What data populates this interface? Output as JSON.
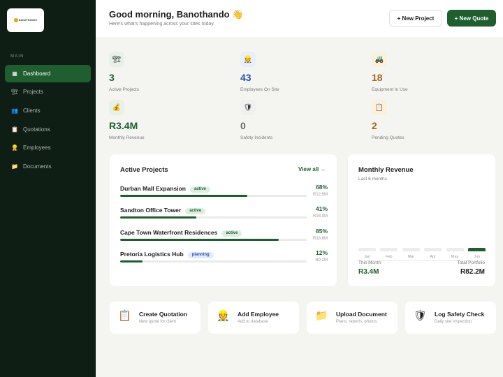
{
  "logo": {
    "text": "BANOTHANDO"
  },
  "sidebar": {
    "section_label": "MAIN",
    "items": [
      {
        "label": "Dashboard",
        "icon": "grid-icon",
        "glyph": "▦",
        "active": true
      },
      {
        "label": "Projects",
        "icon": "crane-icon",
        "glyph": "🏗",
        "active": false
      },
      {
        "label": "Clients",
        "icon": "people-icon",
        "glyph": "👥",
        "active": false
      },
      {
        "label": "Quotations",
        "icon": "clipboard-icon",
        "glyph": "📋",
        "active": false
      },
      {
        "label": "Employees",
        "icon": "worker-icon",
        "glyph": "👷",
        "active": false
      },
      {
        "label": "Documents",
        "icon": "folder-icon",
        "glyph": "📁",
        "active": false
      }
    ]
  },
  "header": {
    "greeting": "Good morning, Banothando 👋",
    "subtitle": "Here's what's happening across your sites today.",
    "new_project_label": "+ New Project",
    "new_quote_label": "+ New Quote"
  },
  "stats": [
    {
      "value": "3",
      "label": "Active Projects",
      "icon": "crane-icon",
      "glyph": "🏗",
      "color": "#1e5e2f",
      "icon_bg": "#e6f1e8"
    },
    {
      "value": "43",
      "label": "Employees On Site",
      "icon": "worker-icon",
      "glyph": "👷",
      "color": "#2b4fb3",
      "icon_bg": "#e8eefb"
    },
    {
      "value": "18",
      "label": "Equipment In Use",
      "icon": "tractor-icon",
      "glyph": "🚜",
      "color": "#9c6a1c",
      "icon_bg": "#fbf0dc"
    },
    {
      "value": "R3.4M",
      "label": "Monthly Revenue",
      "icon": "money-bag-icon",
      "glyph": "💰",
      "color": "#1e5e2f",
      "icon_bg": "#e6f1e8"
    },
    {
      "value": "0",
      "label": "Safety Incidents",
      "icon": "shield-icon",
      "glyph": "🛡",
      "color": "#6b6b6b",
      "icon_bg": "#f0f0f0"
    },
    {
      "value": "2",
      "label": "Pending Quotes",
      "icon": "clipboard-icon",
      "glyph": "📋",
      "color": "#9c6a1c",
      "icon_bg": "#fbf0dc"
    }
  ],
  "projects_card": {
    "title": "Active Projects",
    "view_all": "View all →",
    "items": [
      {
        "name": "Durban Mall Expansion",
        "status": "active",
        "progress": 68,
        "percent": "68%",
        "amount": "R12.5M"
      },
      {
        "name": "Sandton Office Tower",
        "status": "active",
        "progress": 41,
        "percent": "41%",
        "amount": "R28.0M"
      },
      {
        "name": "Cape Town Waterfront Residences",
        "status": "active",
        "progress": 85,
        "percent": "85%",
        "amount": "R18.8M"
      },
      {
        "name": "Pretoria Logistics Hub",
        "status": "planning",
        "progress": 12,
        "percent": "12%",
        "amount": "R9.2M"
      }
    ]
  },
  "revenue_card": {
    "title": "Monthly Revenue",
    "subtitle": "Last 6 months",
    "this_month_label": "This Month",
    "this_month_value": "R3.4M",
    "total_label": "Total Portfolio",
    "total_value": "R82.2M"
  },
  "chart_data": {
    "type": "bar",
    "title": "Monthly Revenue",
    "categories": [
      "Jan",
      "Feb",
      "Mar",
      "Apr",
      "May",
      "Jun"
    ],
    "highlight_color": "#1e5e2f",
    "base_color": "#ecedeb",
    "highlight_index": 5
  },
  "quick_actions": [
    {
      "title": "Create Quotation",
      "subtitle": "New quote for client",
      "icon": "clipboard-icon",
      "glyph": "📋"
    },
    {
      "title": "Add Employee",
      "subtitle": "Add to database",
      "icon": "worker-icon",
      "glyph": "👷"
    },
    {
      "title": "Upload Document",
      "subtitle": "Plans, reports, photos",
      "icon": "folder-icon",
      "glyph": "📁"
    },
    {
      "title": "Log Safety Check",
      "subtitle": "Daily site inspection",
      "icon": "shield-icon",
      "glyph": "🛡"
    }
  ]
}
